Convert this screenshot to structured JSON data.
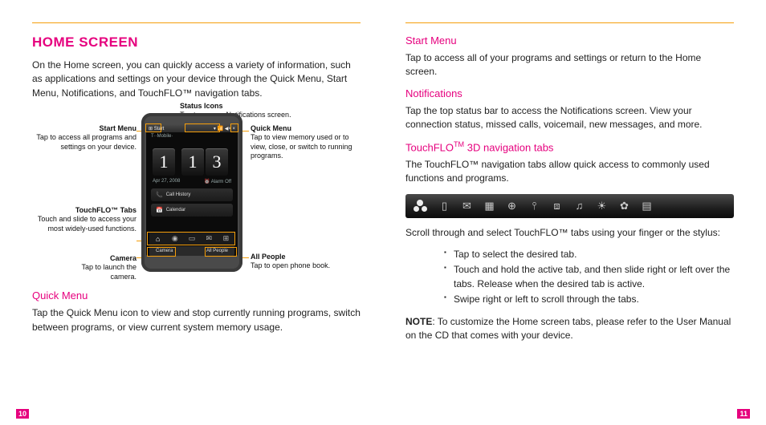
{
  "pages": {
    "left": "10",
    "right": "11"
  },
  "left": {
    "title": "HOME SCREEN",
    "intro": "On the Home screen, you can quickly access a variety of information, such as applications and settings on your device through the Quick Menu, Start Menu, Notifications, and TouchFLO™ navigation tabs.",
    "quickmenu_h": "Quick Menu",
    "quickmenu_p": "Tap the Quick Menu icon to view and stop currently running programs, switch between programs, or view current system memory usage."
  },
  "callouts": {
    "status_h": "Status Icons",
    "status_p": "Tap to access Notifications screen.",
    "startmenu_h": "Start Menu",
    "startmenu_p": "Tap to access all programs and settings on your device.",
    "quickmenu_h": "Quick Menu",
    "quickmenu_p": "Tap to view memory used or to view, close, or switch to running programs.",
    "tabs_h": "TouchFLO™ Tabs",
    "tabs_p": "Touch and slide to access your most widely-used functions.",
    "camera_h": "Camera",
    "camera_p": "Tap to launch the camera.",
    "allpeople_h": "All People",
    "allpeople_p": "Tap to open phone book."
  },
  "phone": {
    "start": "Start",
    "carrier": "T··Mobile·",
    "h1": "1",
    "h2": "1",
    "h3": "3",
    "date": "Apr 27, 2008",
    "alarm": "Alarm Off",
    "row1": "Call History",
    "row2": "Calendar",
    "sk_left": "Camera",
    "sk_right": "All People"
  },
  "right": {
    "startmenu_h": "Start Menu",
    "startmenu_p": "Tap to access all of your programs and settings or return to the Home screen.",
    "notif_h": "Notifications",
    "notif_p": "Tap the top status bar to access the Notifications screen. View your connection status, missed calls, voicemail, new messages, and more.",
    "touchflo_h": "TouchFLO™ 3D navigation tabs",
    "touchflo_p": "The TouchFLO™ navigation tabs allow quick access to commonly used functions and programs.",
    "scroll_p": "Scroll through and select TouchFLO™ tabs using your finger or the stylus:",
    "bul1": "Tap to select the desired tab.",
    "bul2": "Touch and hold the active tab, and then slide right or left over the tabs. Release when the desired tab is active.",
    "bul3": "Swipe right or left to scroll through the tabs.",
    "note_label": "NOTE",
    "note_rest": ": To customize the Home screen tabs, please refer to the User Manual on the CD that comes with your device."
  },
  "tabstrip_icons": [
    "home",
    "people",
    "mail",
    "calendar",
    "web",
    "stocks",
    "camera",
    "music",
    "weather",
    "settings",
    "apps"
  ]
}
